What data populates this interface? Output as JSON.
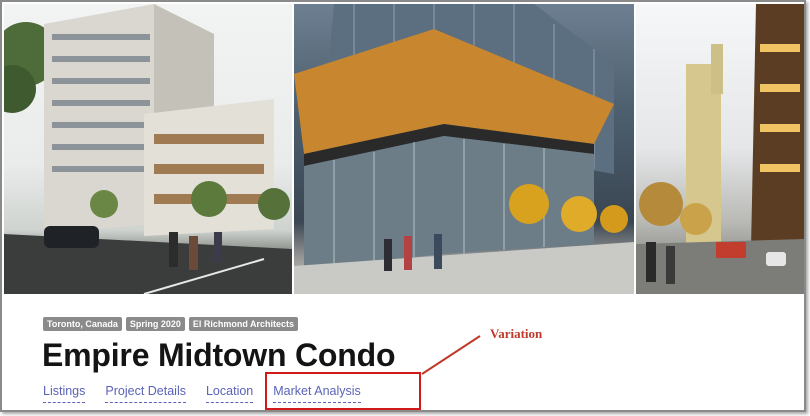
{
  "project": {
    "tags": [
      "Toronto, Canada",
      "Spring 2020",
      "El Richmond Architects"
    ],
    "title": "Empire Midtown Condo"
  },
  "nav": {
    "items": [
      {
        "label": "Listings"
      },
      {
        "label": "Project Details"
      },
      {
        "label": "Location"
      },
      {
        "label": "Market Analysis"
      }
    ]
  },
  "annotation": {
    "label": "Variation",
    "color": "#c0392b",
    "target": "Market Analysis"
  },
  "colors": {
    "link": "#5a63b8",
    "tag_bg": "#8b8b8b",
    "highlight": "#d11a1a"
  }
}
